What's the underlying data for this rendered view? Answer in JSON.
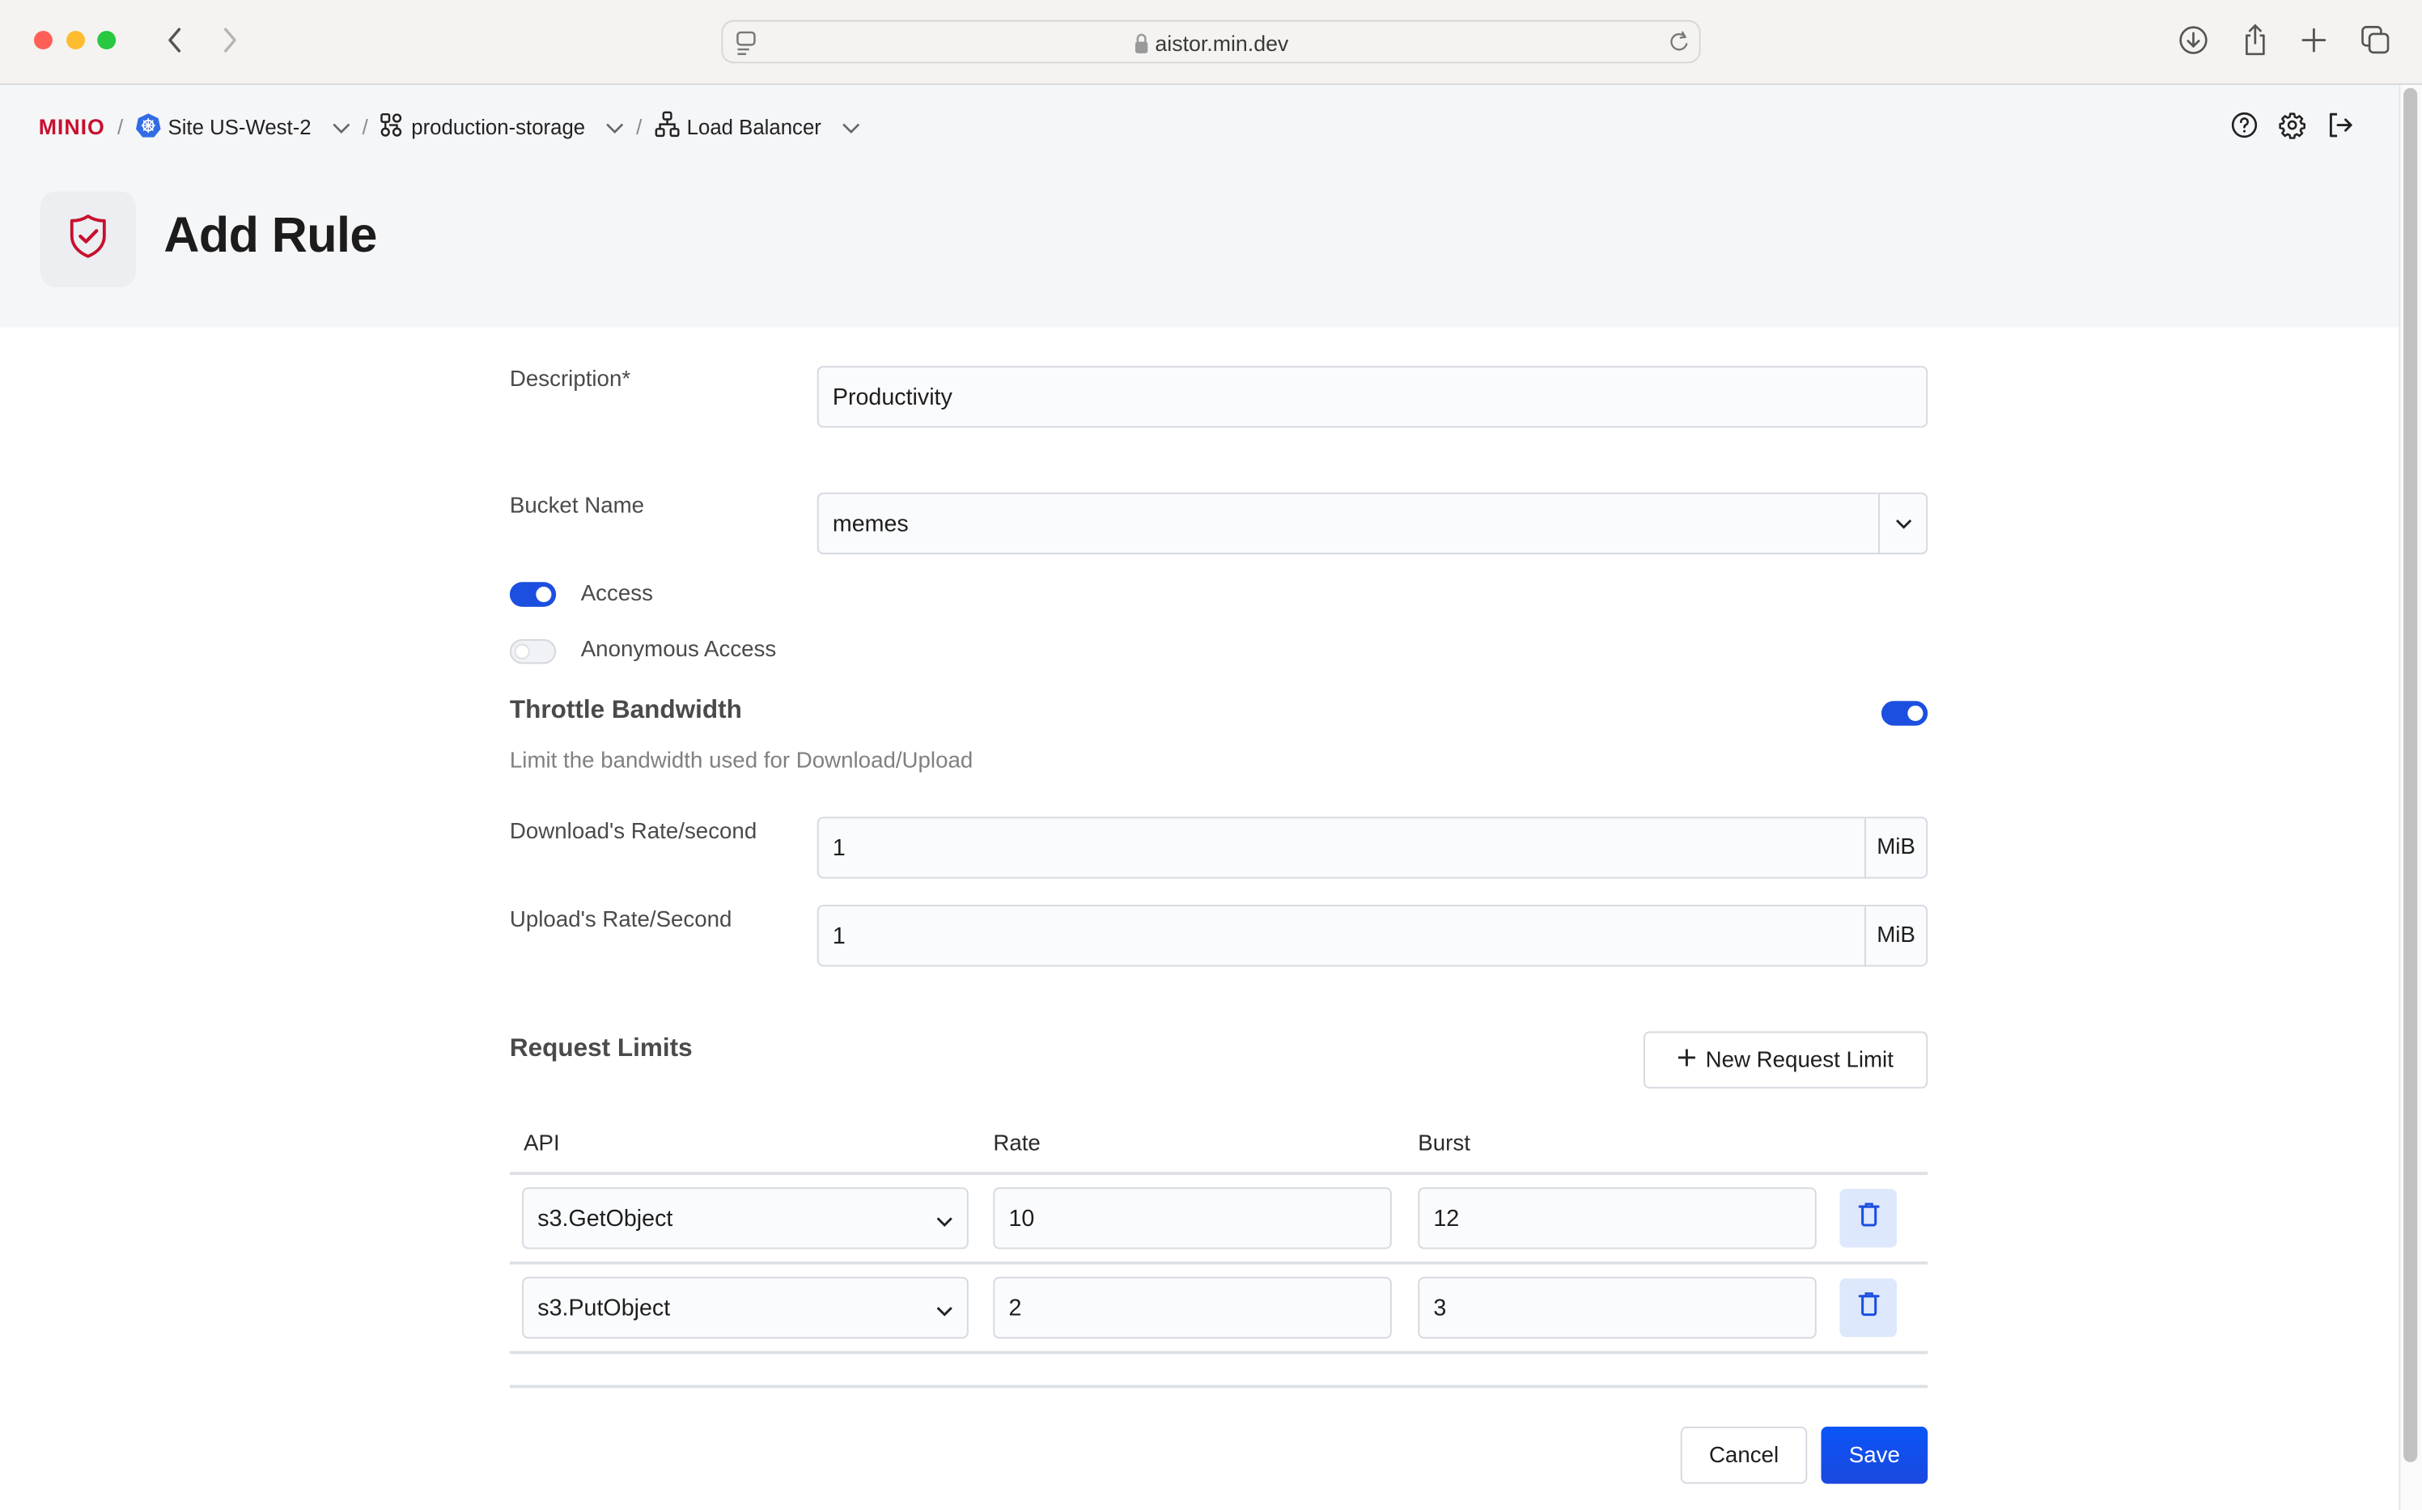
{
  "browser": {
    "url": "aistor.min.dev",
    "icons": [
      "back-icon",
      "forward-icon",
      "sidebar-icon",
      "lock-icon",
      "reload-icon",
      "download-icon",
      "share-icon",
      "new-tab-icon",
      "tabs-overview-icon"
    ]
  },
  "brand": {
    "logo_text": "MINIO",
    "accent": "#c8102e"
  },
  "breadcrumb": [
    {
      "label": "Site US-West-2",
      "icon": "kubernetes-icon"
    },
    {
      "label": "production-storage",
      "icon": "cluster-icon"
    },
    {
      "label": "Load Balancer",
      "icon": "network-icon"
    }
  ],
  "header_actions": [
    "help-icon",
    "settings-icon",
    "logout-icon"
  ],
  "page": {
    "title": "Add Rule",
    "icon": "shield-check-icon"
  },
  "form": {
    "description": {
      "label": "Description*",
      "value": "Productivity"
    },
    "bucket": {
      "label": "Bucket Name",
      "value": "memes"
    },
    "access": {
      "label": "Access",
      "enabled": true
    },
    "anonymous_access": {
      "label": "Anonymous Access",
      "enabled": false
    },
    "throttle": {
      "title": "Throttle Bandwidth",
      "enabled": true,
      "hint": "Limit the bandwidth used for Download/Upload",
      "download": {
        "label": "Download's Rate/second",
        "value": "1",
        "unit": "MiB"
      },
      "upload": {
        "label": "Upload's Rate/Second",
        "value": "1",
        "unit": "MiB"
      }
    },
    "request_limits": {
      "title": "Request Limits",
      "add_label": "New Request Limit",
      "columns": [
        "API",
        "Rate",
        "Burst"
      ],
      "rows": [
        {
          "api": "s3.GetObject",
          "rate": "10",
          "burst": "12"
        },
        {
          "api": "s3.PutObject",
          "rate": "2",
          "burst": "3"
        }
      ]
    },
    "cancel_label": "Cancel",
    "save_label": "Save"
  },
  "colors": {
    "primary": "#1c4fe0",
    "delete_bg": "#dde8fc"
  }
}
